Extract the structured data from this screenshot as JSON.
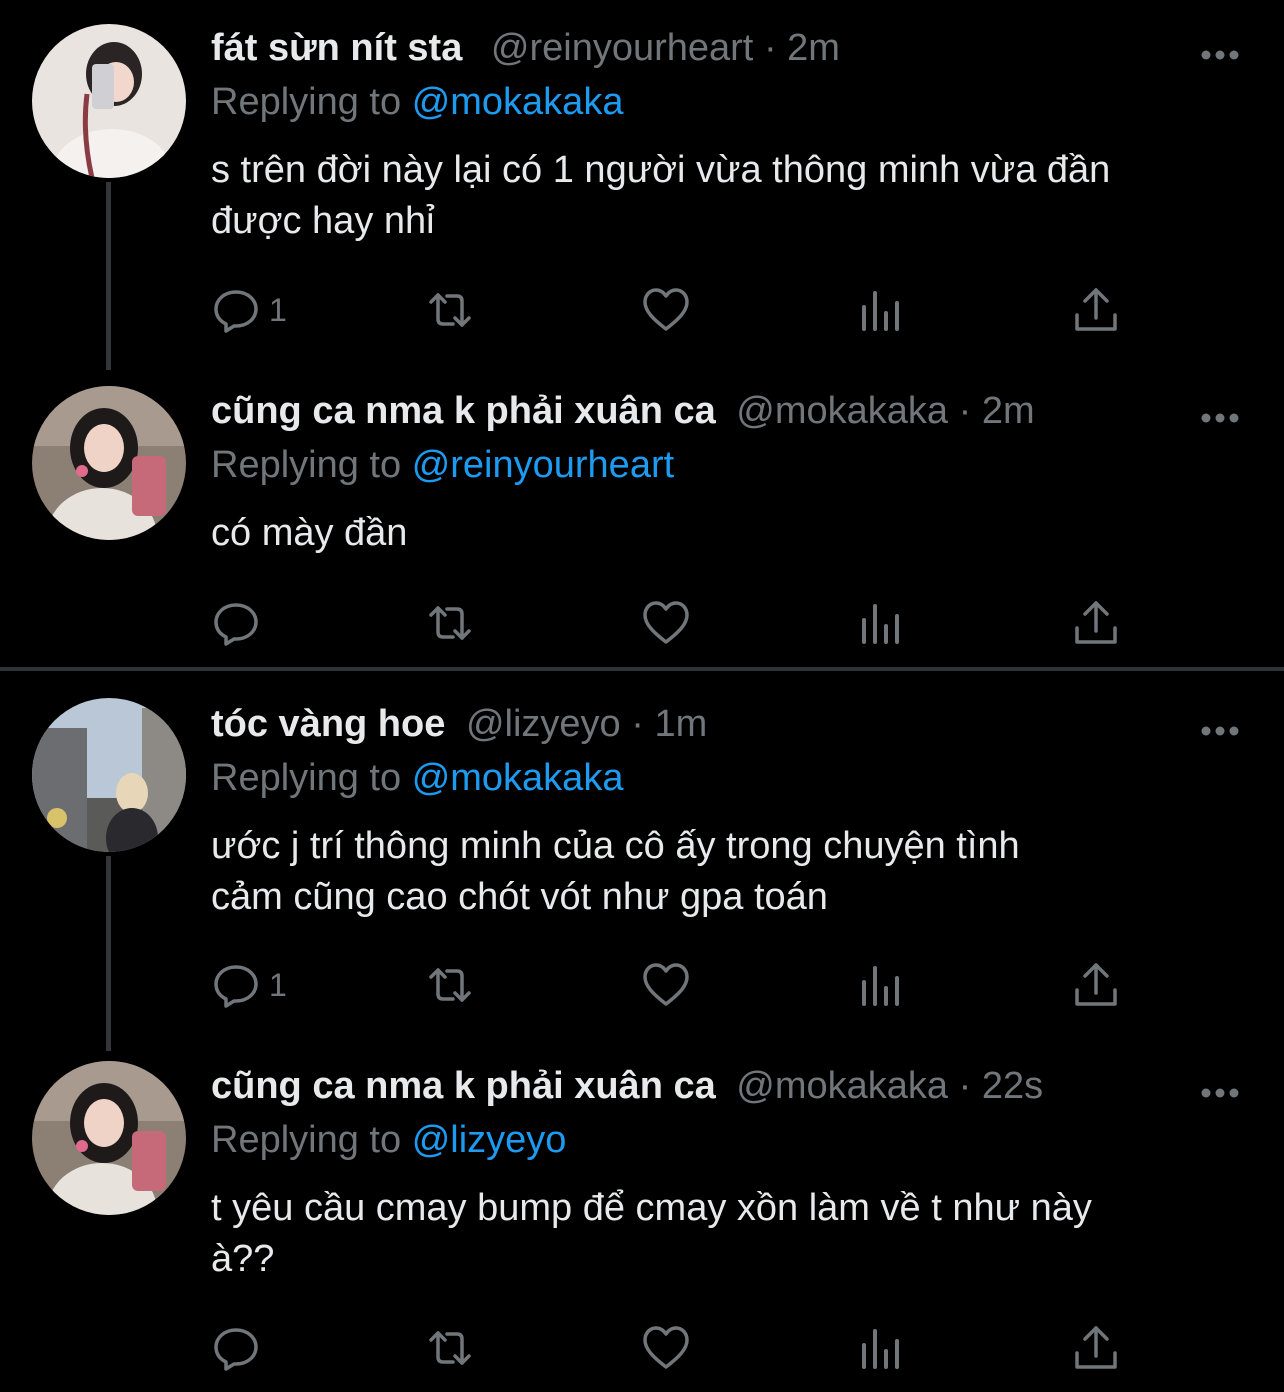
{
  "tweets": [
    {
      "name": "fát sừn nít sta",
      "handle": "@reinyourheart",
      "dot": "·",
      "time": "2m",
      "reply_prefix": "Replying to",
      "reply_mention": "@mokakaka",
      "text_line1": "s trên đời này lại có 1 người vừa thông minh vừa đần",
      "text_line2": "được hay nhỉ",
      "reply_count": "1"
    },
    {
      "name": "cũng ca nma k phải xuân ca",
      "handle": "@mokakaka",
      "dot": "·",
      "time": "2m",
      "reply_prefix": "Replying to",
      "reply_mention": "@reinyourheart",
      "text_line1": "có mày đần",
      "text_line2": "",
      "reply_count": ""
    },
    {
      "name": "tóc vàng hoe",
      "handle": "@lizyeyo",
      "dot": "·",
      "time": "1m",
      "reply_prefix": "Replying to",
      "reply_mention": "@mokakaka",
      "text_line1": "ước j trí thông minh của cô ấy trong chuyện tình",
      "text_line2": "cảm cũng cao chót vót như gpa toán",
      "reply_count": "1"
    },
    {
      "name": "cũng ca nma k phải xuân ca",
      "handle": "@mokakaka",
      "dot": "·",
      "time": "22s",
      "reply_prefix": "Replying to",
      "reply_mention": "@lizyeyo",
      "text_line1": "t yêu cầu cmay bump để cmay xồn làm về t như này",
      "text_line2": "à??",
      "reply_count": ""
    }
  ],
  "icons": {
    "more": "more-horizontal-icon",
    "reply": "reply-bubble-icon",
    "retweet": "retweet-icon",
    "like": "heart-icon",
    "views": "views-bar-chart-icon",
    "share": "share-upload-icon"
  },
  "colors": {
    "background": "#000000",
    "text": "#e7e9ea",
    "muted": "#71767b",
    "link": "#1d9bf0",
    "divider": "#2f3336"
  }
}
